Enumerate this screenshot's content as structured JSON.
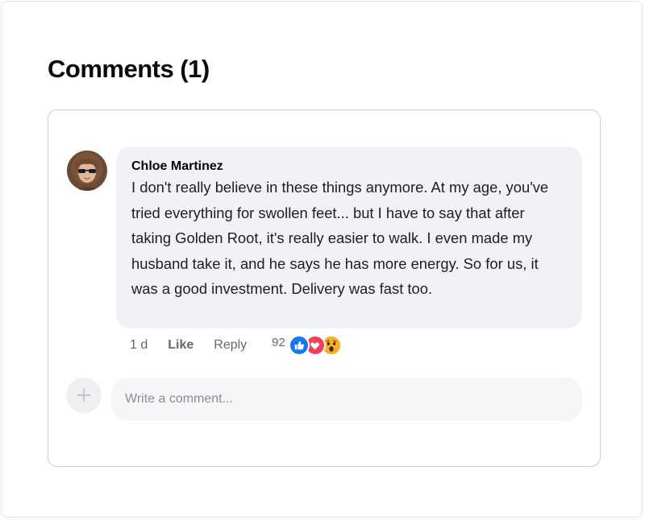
{
  "comments_section": {
    "title": "Comments (1)"
  },
  "comments": [
    {
      "author": "Chloe Martinez",
      "text": "I don't really believe in these things anymore. At my age, you've tried everything for swollen feet... but I have to say that after taking Golden Root, it's really easier to walk. I even made my husband take it, and he says he has more energy. So for us, it was a good investment. Delivery was fast too.",
      "timestamp": "1 d",
      "like_label": "Like",
      "reply_label": "Reply",
      "reaction_count": "92",
      "reactions": [
        "like-icon",
        "love-icon",
        "wow-icon"
      ]
    }
  ],
  "composer": {
    "placeholder": "Write a comment...",
    "value": "",
    "add_icon": "plus-icon"
  },
  "colors": {
    "bubble_bg": "#f0f2f5",
    "like": "#1877f2",
    "love": "#f33e58",
    "wow": "#f7b125",
    "muted_text": "#65676b"
  }
}
